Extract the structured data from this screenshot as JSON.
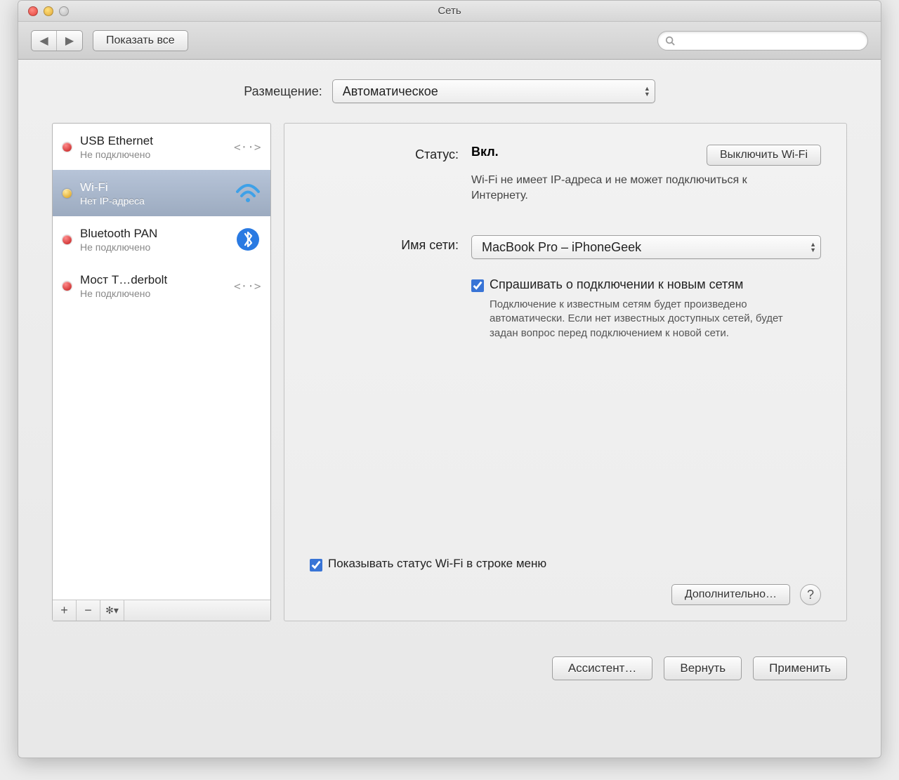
{
  "window": {
    "title": "Сеть"
  },
  "toolbar": {
    "show_all": "Показать все",
    "search_placeholder": ""
  },
  "location": {
    "label": "Размещение:",
    "value": "Автоматическое"
  },
  "sidebar": {
    "items": [
      {
        "name": "USB Ethernet",
        "status": "Не подключено",
        "led": "red",
        "icon": "ethernet"
      },
      {
        "name": "Wi-Fi",
        "status": "Нет IP-адреса",
        "led": "yellow",
        "icon": "wifi",
        "selected": true
      },
      {
        "name": "Bluetooth PAN",
        "status": "Не подключено",
        "led": "red",
        "icon": "bluetooth"
      },
      {
        "name": "Мост T…derbolt",
        "status": "Не подключено",
        "led": "red",
        "icon": "ethernet"
      }
    ]
  },
  "detail": {
    "status_label": "Статус:",
    "status_value": "Вкл.",
    "status_desc": "Wi-Fi не имеет IP-адреса и не может подключиться к Интернету.",
    "turn_off": "Выключить Wi-Fi",
    "network_label": "Имя сети:",
    "network_value": "MacBook Pro – iPhoneGeek",
    "ask_join_label": "Спрашивать о подключении к новым сетям",
    "ask_join_desc": "Подключение к известным сетям будет произведено автоматически. Если нет известных доступных сетей, будет задан вопрос перед подключением к новой сети.",
    "show_menubar": "Показывать статус Wi-Fi в строке меню",
    "advanced": "Дополнительно…"
  },
  "actions": {
    "assist": "Ассистент…",
    "revert": "Вернуть",
    "apply": "Применить"
  }
}
